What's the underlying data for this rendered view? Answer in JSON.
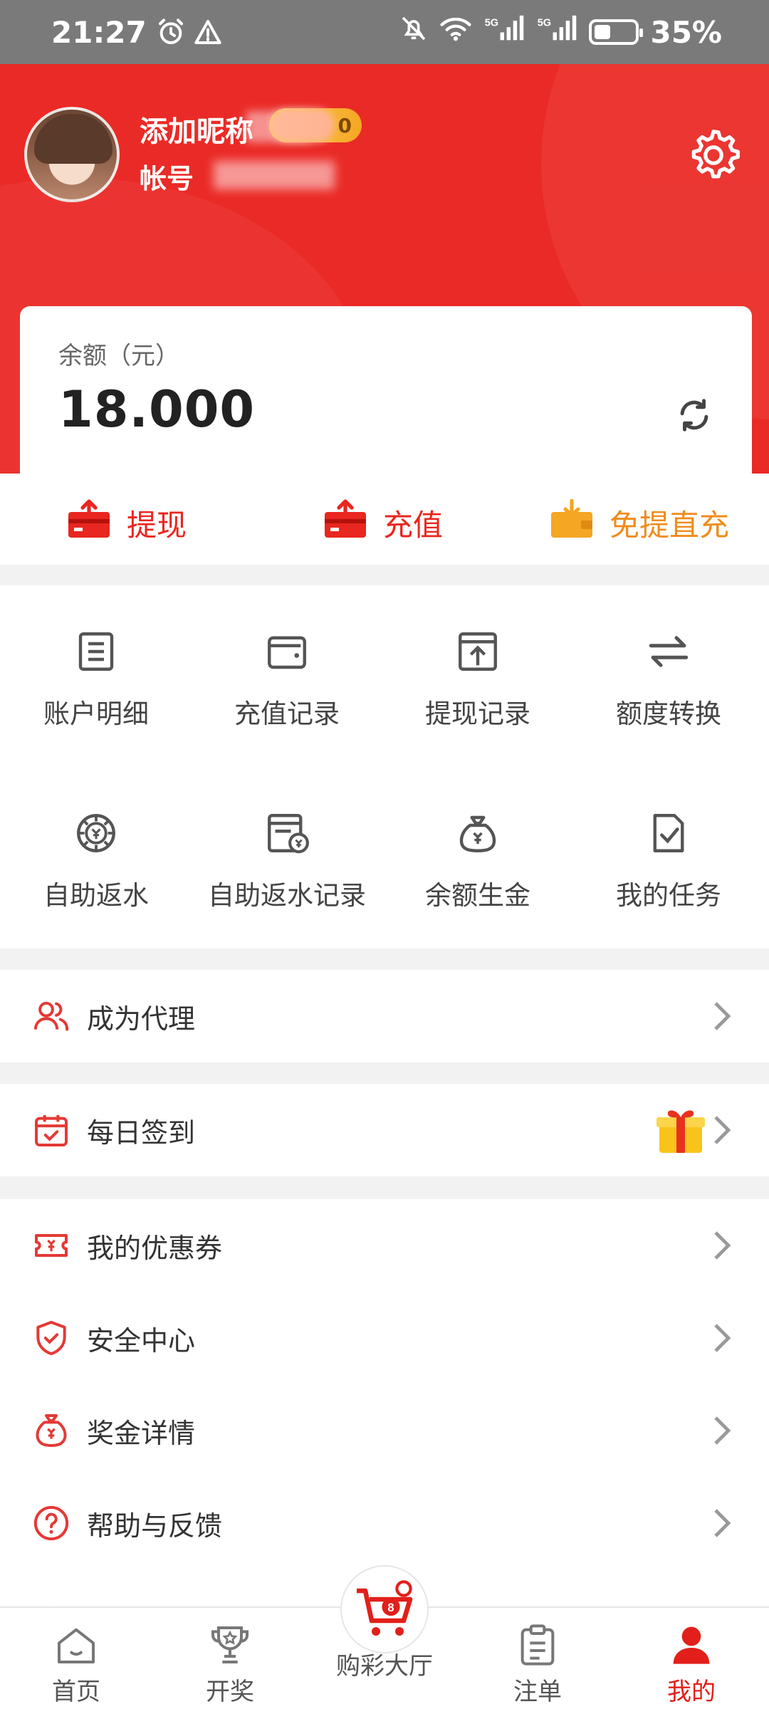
{
  "status_bar": {
    "time": "21:27",
    "battery": "35%",
    "battery_level": 0.35
  },
  "profile": {
    "nickname": "添加昵称",
    "account_label": "帐号",
    "vip_text": "0"
  },
  "balance": {
    "label": "余额（元）",
    "value": "18.000"
  },
  "actions": [
    {
      "label": "提现",
      "icon": "withdraw-card-icon"
    },
    {
      "label": "充值",
      "icon": "recharge-card-icon"
    },
    {
      "label": "免提直充",
      "icon": "direct-recharge-wallet-icon"
    }
  ],
  "grid": [
    {
      "label": "账户明细",
      "icon": "document-list-icon"
    },
    {
      "label": "充值记录",
      "icon": "wallet-icon"
    },
    {
      "label": "提现记录",
      "icon": "upload-box-icon"
    },
    {
      "label": "额度转换",
      "icon": "swap-arrows-icon"
    },
    {
      "label": "自助返水",
      "icon": "chip-yen-icon"
    },
    {
      "label": "自助返水记录",
      "icon": "record-yen-icon"
    },
    {
      "label": "余额生金",
      "icon": "money-bag-icon"
    },
    {
      "label": "我的任务",
      "icon": "task-check-icon"
    }
  ],
  "rows": [
    {
      "label": "成为代理",
      "icon": "users-icon"
    },
    {
      "label": "每日签到",
      "icon": "calendar-check-icon"
    },
    {
      "label": "我的优惠券",
      "icon": "coupon-icon"
    },
    {
      "label": "安全中心",
      "icon": "shield-icon"
    },
    {
      "label": "奖金详情",
      "icon": "prize-bag-icon"
    },
    {
      "label": "帮助与反馈",
      "icon": "help-circle-icon"
    }
  ],
  "nav": [
    {
      "label": "首页",
      "icon": "home-icon"
    },
    {
      "label": "开奖",
      "icon": "trophy-icon"
    },
    {
      "label": "购彩大厅",
      "icon": "cart-icon"
    },
    {
      "label": "注单",
      "icon": "clipboard-icon"
    },
    {
      "label": "我的",
      "icon": "user-icon"
    }
  ],
  "colors": {
    "brand_red": "#ea2a26",
    "orange": "#f08c1b",
    "active_nav": "#e21f1a"
  }
}
